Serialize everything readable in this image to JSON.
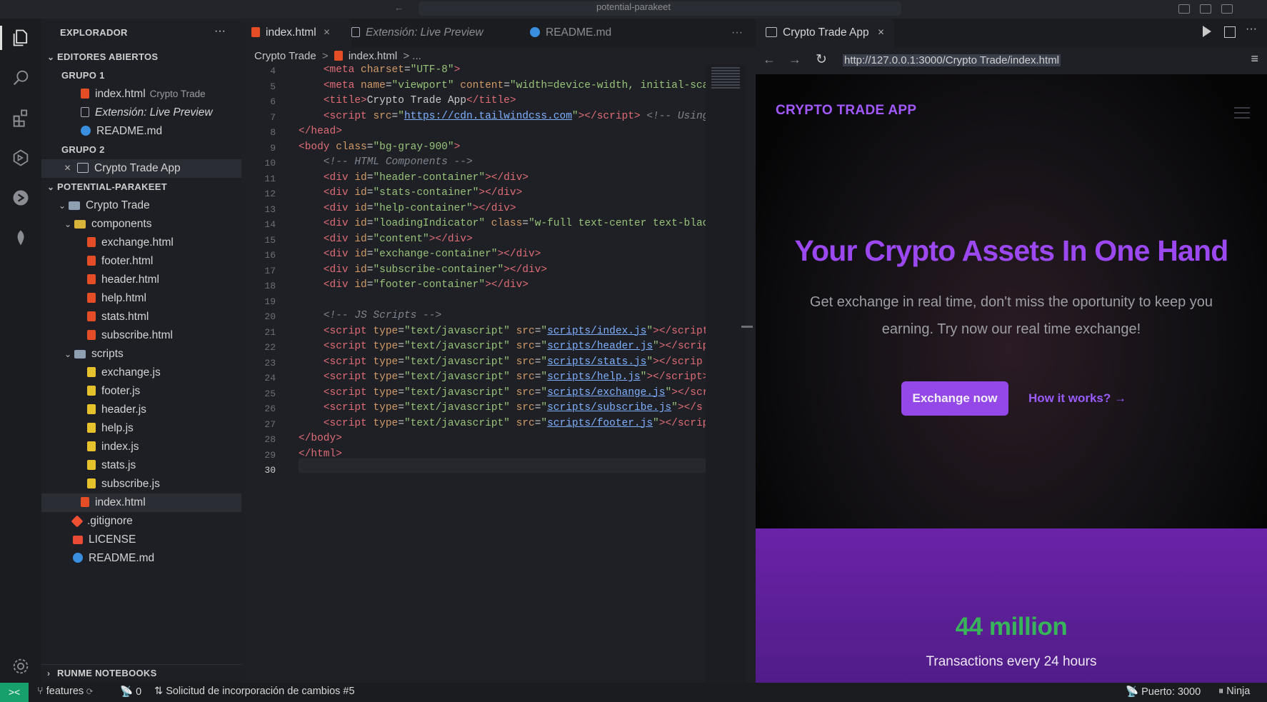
{
  "titlebar": {
    "title": "potential-parakeet"
  },
  "activity_bar": {
    "icons": [
      "files-icon",
      "search-icon",
      "extensions-icon",
      "remote-explorer-icon",
      "live-share-icon",
      "database-icon",
      "settings-gear-icon"
    ]
  },
  "sidebar": {
    "header": "EXPLORADOR",
    "more": "···",
    "open_editors": {
      "title": "EDITORES ABIERTOS",
      "group1": {
        "title": "GRUPO 1",
        "items": [
          {
            "name": "index.html",
            "desc": "Crypto Trade"
          },
          {
            "name": "Extensión: Live Preview",
            "desc": ""
          },
          {
            "name": "README.md",
            "desc": ""
          }
        ]
      },
      "group2": {
        "title": "GRUPO 2",
        "items": [
          {
            "name": "Crypto Trade App",
            "close": "×"
          }
        ]
      }
    },
    "project": {
      "title": "POTENTIAL-PARAKEET",
      "root_folder": "Crypto Trade",
      "components_folder": "components",
      "components": [
        "exchange.html",
        "footer.html",
        "header.html",
        "help.html",
        "stats.html",
        "subscribe.html"
      ],
      "scripts_folder": "scripts",
      "scripts": [
        "exchange.js",
        "footer.js",
        "header.js",
        "help.js",
        "index.js",
        "stats.js",
        "subscribe.js"
      ],
      "index_file": "index.html",
      "root_files": [
        ".gitignore",
        "LICENSE",
        "README.md"
      ]
    },
    "runme": "RUNME NOTEBOOKS"
  },
  "editor": {
    "tabs": [
      {
        "label": "index.html",
        "close": "×"
      },
      {
        "label": "Extensión: Live Preview"
      },
      {
        "label": "README.md"
      }
    ],
    "more": "···",
    "breadcrumb": {
      "folder": "Crypto Trade",
      "sep": ">",
      "file": "index.html",
      "rest": "> ..."
    },
    "line_numbers": [
      "4",
      "5",
      "6",
      "7",
      "8",
      "9",
      "10",
      "11",
      "12",
      "13",
      "14",
      "15",
      "16",
      "17",
      "18",
      "19",
      "20",
      "21",
      "22",
      "23",
      "24",
      "25",
      "26",
      "27",
      "28",
      "29",
      "30"
    ]
  },
  "preview": {
    "tab_label": "Crypto Trade App",
    "tab_close": "×",
    "url": "http://127.0.0.1:3000/Crypto Trade/index.html",
    "site": {
      "brand": "CRYPTO TRADE APP",
      "hero": "Your Crypto Assets In One Hand",
      "description": "Get exchange in real time, don't miss the oportunity to keep you earning. Try now our real time exchange!",
      "primary_button": "Exchange now",
      "secondary_link": "How it works? →",
      "stat_value": "44 million",
      "stat_label": "Transactions every 24 hours"
    }
  },
  "statusbar": {
    "branch": "features",
    "ports_count": "0",
    "pr": "Solicitud de incorporación de cambios #5",
    "port": "Puerto: 3000",
    "ninja": "Ninja"
  },
  "colors": {
    "accent": "#9448e8",
    "stat_green": "#38b45a",
    "remote": "#18a06c"
  }
}
